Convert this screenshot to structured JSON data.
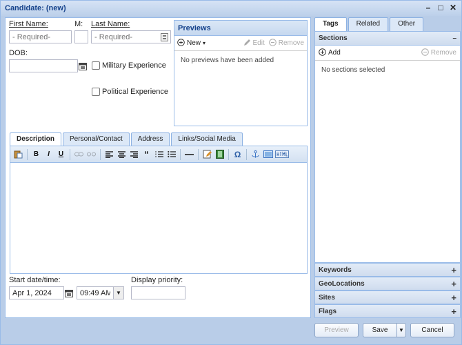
{
  "window": {
    "title": "Candidate: (new)"
  },
  "form": {
    "first_name_label": "First Name:",
    "first_name_placeholder": "- Required-",
    "mi_label": "M:",
    "last_name_label": "Last Name:",
    "last_name_placeholder": "- Required-",
    "dob_label": "DOB:",
    "military_label": "Military Experience",
    "political_label": "Political Experience",
    "start_label": "Start date/time:",
    "start_date": "Apr 1, 2024",
    "start_time": "09:49 AM",
    "priority_label": "Display priority:"
  },
  "previews": {
    "title": "Previews",
    "new_label": "New",
    "edit_label": "Edit",
    "remove_label": "Remove",
    "empty_text": "No previews have been added"
  },
  "tabs": [
    "Description",
    "Personal/Contact",
    "Address",
    "Links/Social Media"
  ],
  "right_tabs": [
    "Tags",
    "Related",
    "Other"
  ],
  "sections": {
    "title": "Sections",
    "add_label": "Add",
    "remove_label": "Remove",
    "empty_text": "No sections selected"
  },
  "accordion": [
    "Keywords",
    "GeoLocations",
    "Sites",
    "Flags"
  ],
  "footer": {
    "preview": "Preview",
    "save": "Save",
    "cancel": "Cancel"
  }
}
